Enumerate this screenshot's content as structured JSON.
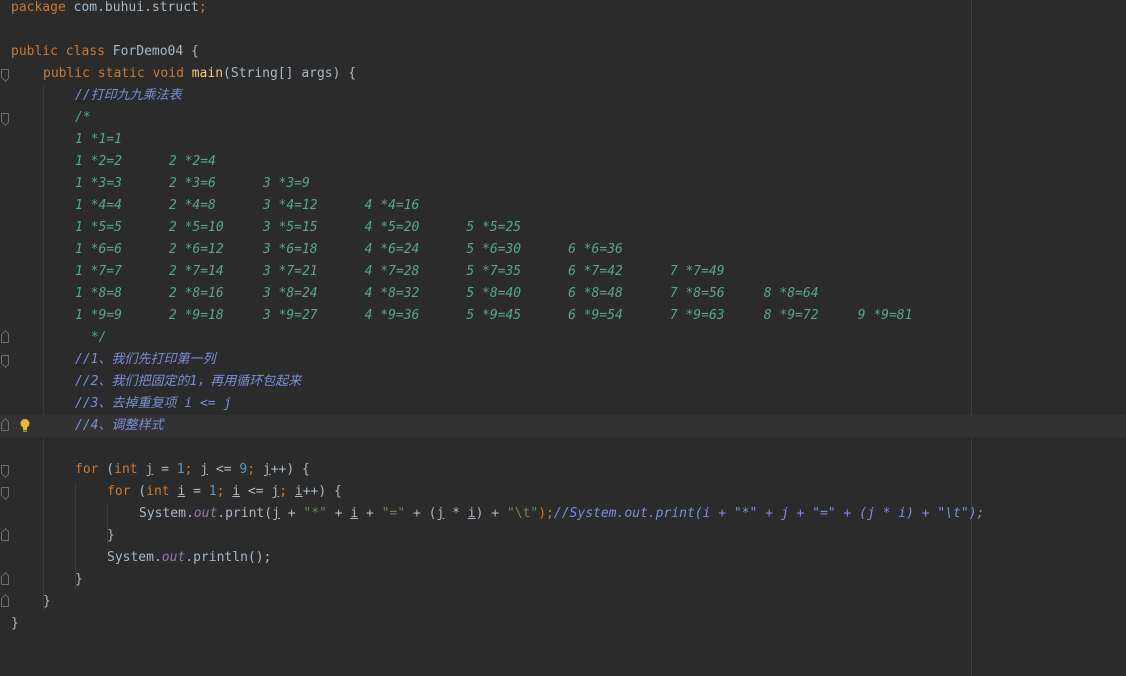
{
  "editor": {
    "package_kw": "package",
    "package_name": "com.buhui.struct",
    "semicolon": ";",
    "public_kw": "public",
    "class_kw": "class",
    "class_name": "ForDemo04",
    "open_brace": " {",
    "static_kw": "static",
    "void_kw": "void",
    "main_name": "main",
    "main_params": "(String[] args) {",
    "comment_title": "//打印九九乘法表",
    "block_open": "/*",
    "table_rows": [
      "1 *1=1",
      "1 *2=2      2 *2=4",
      "1 *3=3      2 *3=6      3 *3=9",
      "1 *4=4      2 *4=8      3 *4=12      4 *4=16",
      "1 *5=5      2 *5=10     3 *5=15      4 *5=20      5 *5=25",
      "1 *6=6      2 *6=12     3 *6=18      4 *6=24      5 *6=30      6 *6=36",
      "1 *7=7      2 *7=14     3 *7=21      4 *7=28      5 *7=35      6 *7=42      7 *7=49",
      "1 *8=8      2 *8=16     3 *8=24      4 *8=32      5 *8=40      6 *8=48      7 *8=56     8 *8=64",
      "1 *9=9      2 *9=18     3 *9=27      4 *9=36      5 *9=45      6 *9=54      7 *9=63     8 *9=72     9 *9=81"
    ],
    "block_close": " */",
    "step_comments": [
      "//1、我们先打印第一列",
      "//2、我们把固定的1，再用循环包起来",
      "//3、去掉重复项 i <= j",
      "//4、调整样式"
    ],
    "for_kw": "for",
    "int_kw": "int",
    "outer_for": {
      "open": " (",
      "var": "j",
      "eq": " = ",
      "init": "1",
      "cond_var": "j",
      "cond_op": " <= ",
      "cond_val": "9",
      "inc_var": "j",
      "tail": "++) {"
    },
    "inner_for": {
      "open": " (",
      "var": "i",
      "eq": " = ",
      "init": "1",
      "cond_var": "i",
      "cond_op": " <= ",
      "cond_val": "j",
      "inc_var": "i",
      "tail": "++) {"
    },
    "print_line": {
      "system": "System.",
      "out": "out",
      "print": ".print(",
      "j1": "j",
      "plus1": " + ",
      "star": "\"*\"",
      "plus2": " + ",
      "i1": "i",
      "plus3": " + ",
      "eqstr": "\"=\"",
      "plus4": " + (",
      "j2": "j",
      "times": " * ",
      "i2": "i",
      "plus5": ") + ",
      "tab": "\"\\t\"",
      "close": ");",
      "trailing_comment": "//System.out.print(i + \"*\" + j + \"=\" + (j * i) + \"\\t\");"
    },
    "close_brace": "}",
    "println_line": {
      "system": "System.",
      "out": "out",
      "println": ".println();"
    },
    "colors": {
      "background": "#2b2b2b",
      "current_line": "#323232",
      "keyword": "#cc7832",
      "string": "#6a8759",
      "number": "#6897bb",
      "method": "#ffc66d",
      "field": "#9876aa",
      "doc_comment": "#58a68c",
      "line_comment": "#7a8ed6"
    },
    "icons": [
      "fold-icon",
      "lightbulb-icon"
    ]
  }
}
